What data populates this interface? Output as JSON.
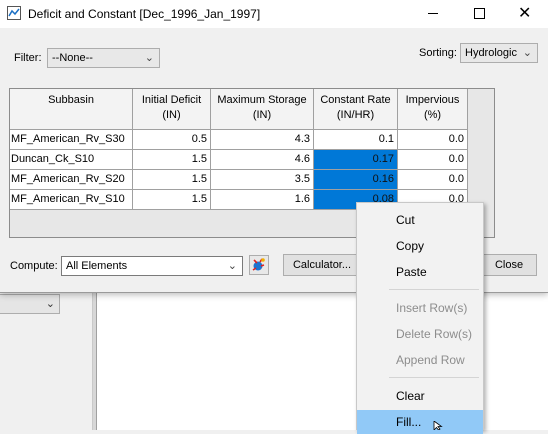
{
  "window": {
    "title": "Deficit and Constant [Dec_1996_Jan_1997]"
  },
  "filter": {
    "label": "Filter:",
    "value": "--None--"
  },
  "sorting": {
    "label": "Sorting:",
    "value": "Hydrologic"
  },
  "table": {
    "headers": [
      "Subbasin",
      "Initial Deficit\n(IN)",
      "Maximum Storage\n(IN)",
      "Constant Rate\n(IN/HR)",
      "Impervious\n(%)"
    ],
    "rows": [
      [
        "MF_American_Rv_S30",
        "0.5",
        "4.3",
        "0.1",
        "0.0"
      ],
      [
        "Duncan_Ck_S10",
        "1.5",
        "4.6",
        "0.17",
        "0.0"
      ],
      [
        "MF_American_Rv_S20",
        "1.5",
        "3.5",
        "0.16",
        "0.0"
      ],
      [
        "MF_American_Rv_S10",
        "1.5",
        "1.6",
        "0.08",
        "0.0"
      ]
    ],
    "selection_color": "#0078d7"
  },
  "compute": {
    "label": "Compute:",
    "value": "All Elements"
  },
  "buttons": {
    "calculator": "Calculator...",
    "close": "Close"
  },
  "context_menu": {
    "items": [
      {
        "label": "Cut",
        "enabled": true
      },
      {
        "label": "Copy",
        "enabled": true
      },
      {
        "label": "Paste",
        "enabled": true
      },
      {
        "label": "Insert Row(s)",
        "enabled": false
      },
      {
        "label": "Delete Row(s)",
        "enabled": false
      },
      {
        "label": "Append Row",
        "enabled": false
      },
      {
        "label": "Clear",
        "enabled": true
      },
      {
        "label": "Fill...",
        "enabled": true,
        "highlighted": true
      }
    ],
    "highlight_color": "#91c9f7"
  }
}
